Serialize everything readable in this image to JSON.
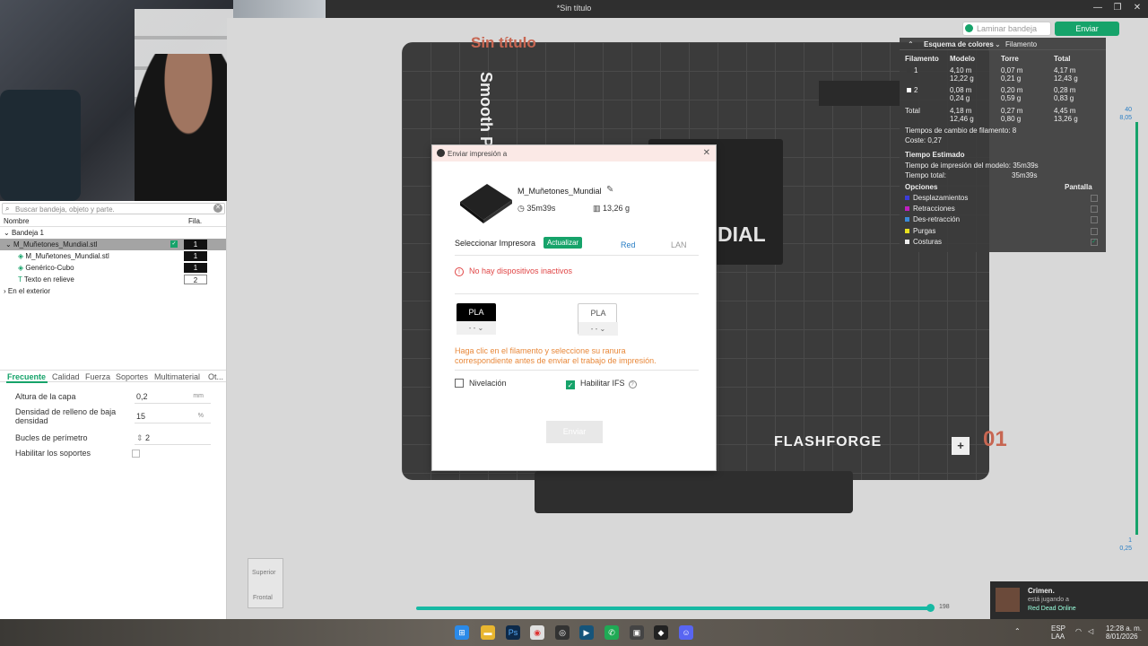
{
  "window": {
    "title": "*Sin título",
    "minimize": "—",
    "maximize": "❐",
    "close": "✕"
  },
  "toolbar": {
    "slice_label": "Laminar bandeja",
    "send_label": "Enviar"
  },
  "scene": {
    "plate_title": "Sin título",
    "plate_text": "Smooth PEI",
    "brand": "FLASHFORGE",
    "plate_number": "01",
    "model_text": "DIAL"
  },
  "stats": {
    "header_scheme": "Esquema de colores",
    "header_mode": "Filamento",
    "columns": [
      "Filamento",
      "Modelo",
      "Torre",
      "Total"
    ],
    "rows": [
      {
        "id": "1",
        "color": "#3a3a3a",
        "modelo": [
          "4,10 m",
          "12,22 g"
        ],
        "torre": [
          "0,07 m",
          "0,21 g"
        ],
        "total": [
          "4,17 m",
          "12,43 g"
        ]
      },
      {
        "id": "2",
        "color": "#ffffff",
        "modelo": [
          "0,08 m",
          "0,24 g"
        ],
        "torre": [
          "0,20 m",
          "0,59 g"
        ],
        "total": [
          "0,28 m",
          "0,83 g"
        ]
      }
    ],
    "total": {
      "label": "Total",
      "modelo": [
        "4,18 m",
        "12,46 g"
      ],
      "torre": [
        "0,27 m",
        "0,80 g"
      ],
      "total": [
        "4,45 m",
        "13,26 g"
      ]
    },
    "change_times": "Tiempos de cambio de filamento:  8",
    "cost": "Coste:  0,27",
    "estimated": "Tiempo Estimado",
    "model_time": "Tiempo de impresión del modelo:  35m39s",
    "total_time_label": "Tiempo total:",
    "total_time": "35m39s",
    "options_label": "Opciones",
    "screen_label": "Pantalla",
    "options": [
      {
        "label": "Desplazamientos",
        "color": "#3c3cd8"
      },
      {
        "label": "Retracciones",
        "color": "#c020c0"
      },
      {
        "label": "Des-retracción",
        "color": "#3a8ad8"
      },
      {
        "label": "Purgas",
        "color": "#e8e020"
      },
      {
        "label": "Costuras",
        "color": "#eeeeee"
      }
    ]
  },
  "left": {
    "search_placeholder": "Buscar bandeja, objeto y parte.",
    "col_name": "Nombre",
    "col_fila": "Fila.",
    "tree": [
      {
        "label": "Bandeja 1",
        "fila": ""
      },
      {
        "label": "M_Muñetones_Mundial.stl",
        "fila": "1"
      },
      {
        "label": "M_Muñetones_Mundial.stl",
        "fila": "1"
      },
      {
        "label": "Genérico-Cubo",
        "fila": "1"
      },
      {
        "label": "Texto en relieve",
        "fila": "2"
      },
      {
        "label": "En el exterior",
        "fila": ""
      }
    ],
    "tabs": [
      "Frecuente",
      "Calidad",
      "Fuerza",
      "Soportes",
      "Multimaterial",
      "Ot..."
    ],
    "params": [
      {
        "label": "Altura de la capa",
        "value": "0,2",
        "unit": "mm"
      },
      {
        "label": "Densidad de relleno de baja densidad",
        "value": "15",
        "unit": "%"
      },
      {
        "label": "Bucles de perímetro",
        "value": "2",
        "unit": ""
      },
      {
        "label": "Habilitar los soportes",
        "value": "",
        "unit": ""
      }
    ]
  },
  "dialog": {
    "title": "Enviar impresión a",
    "file_name": "M_Muñetones_Mundial",
    "time": "35m39s",
    "weight": "13,26 g",
    "select_printer": "Seleccionar Impresora",
    "update": "Actualizar",
    "tab_red": "Red",
    "tab_lan": "LAN",
    "warning": "No hay dispositivos inactivos",
    "filament1": "PLA",
    "filament2": "PLA",
    "dropdown": "- -",
    "hint": "Haga clic en el filamento y seleccione su ranura correspondiente antes de enviar el trabajo de impresión.",
    "leveling": "Nivelación",
    "ifs": "Habilitar IFS",
    "send": "Enviar"
  },
  "sliders": {
    "top_value": "40",
    "top_height": "8,05",
    "bottom_value": "1",
    "bottom_height": "0,25",
    "horizontal_value": "198"
  },
  "viewcube": {
    "top": "Superior",
    "front": "Frontal"
  },
  "notification": {
    "name": "Crimen.",
    "status": "está jugando a",
    "game": "Red Dead Online"
  },
  "taskbar": {
    "lang": "ESP",
    "lang2": "LAA",
    "time": "12:28 a. m.",
    "date": "8/01/2026"
  }
}
